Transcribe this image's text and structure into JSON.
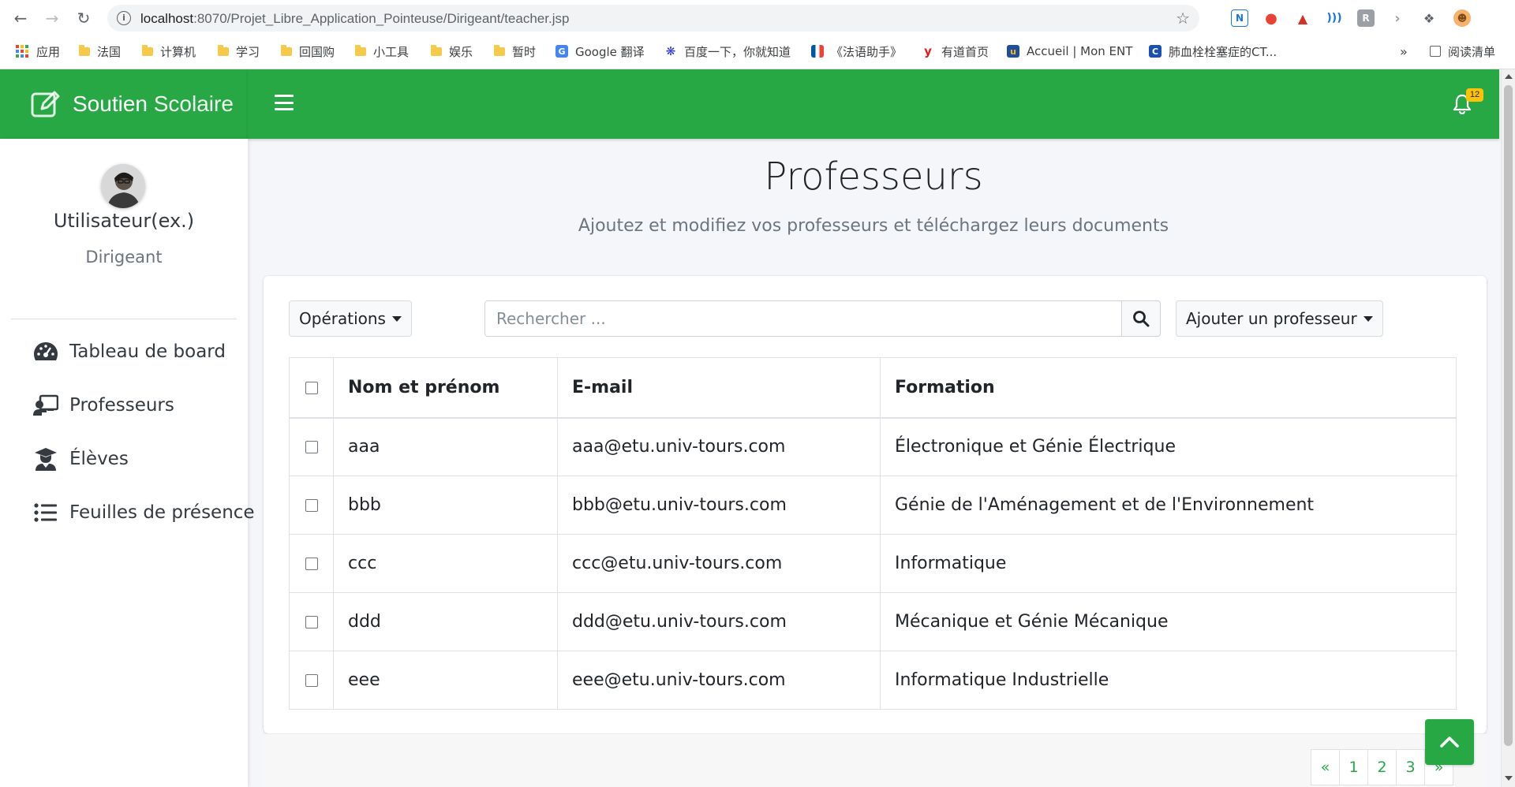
{
  "browser": {
    "url_host": "localhost",
    "url_path": ":8070/Projet_Libre_Application_Pointeuse/Dirigeant/teacher.jsp",
    "bookmarks": [
      {
        "label": "应用",
        "icon": "apps-icon"
      },
      {
        "label": "法国",
        "icon": "folder-icon"
      },
      {
        "label": "计算机",
        "icon": "folder-icon"
      },
      {
        "label": "学习",
        "icon": "folder-icon"
      },
      {
        "label": "回国购",
        "icon": "folder-icon"
      },
      {
        "label": "小工具",
        "icon": "folder-icon"
      },
      {
        "label": "娱乐",
        "icon": "folder-icon"
      },
      {
        "label": "暂时",
        "icon": "folder-icon"
      },
      {
        "label": "Google 翻译",
        "icon": "google-translate-icon"
      },
      {
        "label": "百度一下，你就知道",
        "icon": "baidu-icon"
      },
      {
        "label": "《法语助手》",
        "icon": "french-flag-icon"
      },
      {
        "label": "有道首页",
        "icon": "youdao-icon"
      },
      {
        "label": "Accueil | Mon ENT",
        "icon": "ent-icon"
      },
      {
        "label": "肺血栓栓塞症的CT...",
        "icon": "article-icon"
      }
    ],
    "overflow_label": "»",
    "reading_list_label": "阅读清单"
  },
  "app": {
    "brand_bold": "Soutien",
    "brand_light": "Scolaire",
    "notification_count": "12",
    "colors": {
      "primary": "#28a745",
      "badge": "#ffc107"
    }
  },
  "sidebar": {
    "user_name": "Utilisateur(ex.)",
    "user_role": "Dirigeant",
    "items": [
      {
        "label": "Tableau de board",
        "icon": "tachometer-icon"
      },
      {
        "label": "Professeurs",
        "icon": "chalkboard-teacher-icon"
      },
      {
        "label": "Élèves",
        "icon": "user-graduate-icon"
      },
      {
        "label": "Feuilles de présence",
        "icon": "list-icon"
      }
    ]
  },
  "main": {
    "title": "Professeurs",
    "subtitle": "Ajoutez et modifiez vos professeurs et téléchargez leurs documents",
    "operations_label": "Opérations",
    "search_placeholder": "Rechercher ...",
    "add_label": "Ajouter un professeur",
    "table": {
      "headers": [
        "Nom et prénom",
        "E-mail",
        "Formation"
      ],
      "rows": [
        {
          "name": "aaa",
          "email": "aaa@etu.univ-tours.com",
          "formation": "Électronique et Génie Électrique"
        },
        {
          "name": "bbb",
          "email": "bbb@etu.univ-tours.com",
          "formation": "Génie de l'Aménagement et de l'Environnement"
        },
        {
          "name": "ccc",
          "email": "ccc@etu.univ-tours.com",
          "formation": "Informatique"
        },
        {
          "name": "ddd",
          "email": "ddd@etu.univ-tours.com",
          "formation": "Mécanique et Génie Mécanique"
        },
        {
          "name": "eee",
          "email": "eee@etu.univ-tours.com",
          "formation": "Informatique Industrielle"
        }
      ]
    },
    "pagination": {
      "prev": "«",
      "pages": [
        "1",
        "2",
        "3"
      ],
      "next": "»"
    }
  }
}
